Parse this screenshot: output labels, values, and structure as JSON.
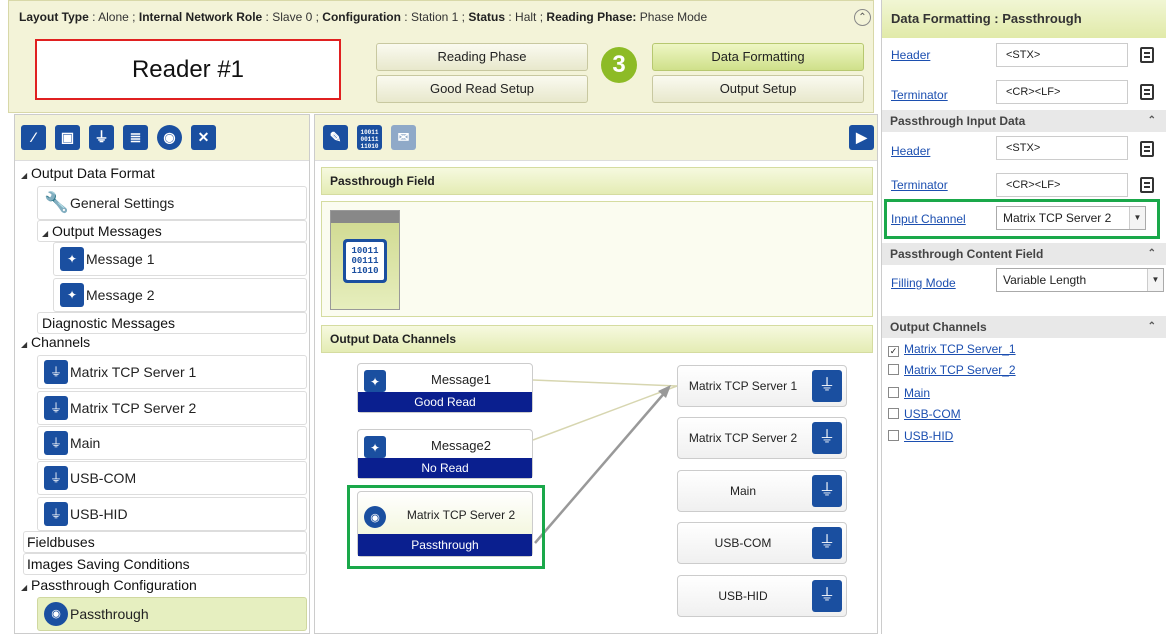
{
  "header": {
    "status": [
      {
        "key": "Layout Type",
        "value": "Alone"
      },
      {
        "key": "Internal Network Role",
        "value": "Slave 0"
      },
      {
        "key": "Configuration",
        "value": "Station 1"
      },
      {
        "key": "Status",
        "value": "Halt"
      },
      {
        "key": "Reading Phase:",
        "value": "Phase Mode"
      }
    ],
    "reader_label": "Reader #1",
    "step_number": "3",
    "buttons": {
      "reading_phase": "Reading Phase",
      "good_read_setup": "Good Read Setup",
      "data_formatting": "Data Formatting",
      "output_setup": "Output Setup"
    },
    "collapse_glyph": "⌃"
  },
  "left_tree": {
    "output_data_format": "Output Data Format",
    "general_settings": "General Settings",
    "output_messages": "Output Messages",
    "message_1": "Message 1",
    "message_2": "Message 2",
    "diagnostic_messages": "Diagnostic Messages",
    "channels": "Channels",
    "channel_items": [
      "Matrix TCP Server 1",
      "Matrix TCP Server 2",
      "Main",
      "USB-COM",
      "USB-HID"
    ],
    "fieldbuses": "Fieldbuses",
    "images_saving": "Images Saving Conditions",
    "passthrough_config": "Passthrough Configuration",
    "passthrough": "Passthrough"
  },
  "center": {
    "passthrough_field": "Passthrough Field",
    "output_data_channels": "Output Data Channels",
    "binary_text": "10011\n00111\n11010",
    "sources": [
      {
        "title": "Message1",
        "bar": "Good Read"
      },
      {
        "title": "Message2",
        "bar": "No Read"
      },
      {
        "title": "Matrix TCP Server 2",
        "bar": "Passthrough"
      }
    ],
    "outputs": [
      "Matrix TCP Server 1",
      "Matrix TCP Server 2",
      "Main",
      "USB-COM",
      "USB-HID"
    ]
  },
  "right": {
    "title": "Data Formatting : Passthrough",
    "header_label": "Header",
    "header_value": "<STX>",
    "terminator_label": "Terminator",
    "terminator_value": "<CR><LF>",
    "input_section": "Passthrough Input Data",
    "in_header_label": "Header",
    "in_header_value": "<STX>",
    "in_terminator_label": "Terminator",
    "in_terminator_value": "<CR><LF>",
    "input_channel_label": "Input Channel",
    "input_channel_value": "Matrix TCP Server 2",
    "content_section": "Passthrough Content Field",
    "filling_mode_label": "Filling Mode",
    "filling_mode_value": "Variable Length",
    "output_section": "Output Channels",
    "output_channels": [
      {
        "label": "Matrix TCP Server_1",
        "checked": true
      },
      {
        "label": "Matrix TCP Server_2",
        "checked": false
      },
      {
        "label": "Main",
        "checked": false
      },
      {
        "label": "USB-COM",
        "checked": false
      },
      {
        "label": "USB-HID",
        "checked": false
      }
    ]
  },
  "colors": {
    "accent_green": "#8dbb26",
    "highlight_green": "#1aa84a",
    "highlight_red": "#e02020",
    "icon_blue": "#1a4fa0",
    "bar_navy": "#0a1f8f"
  }
}
